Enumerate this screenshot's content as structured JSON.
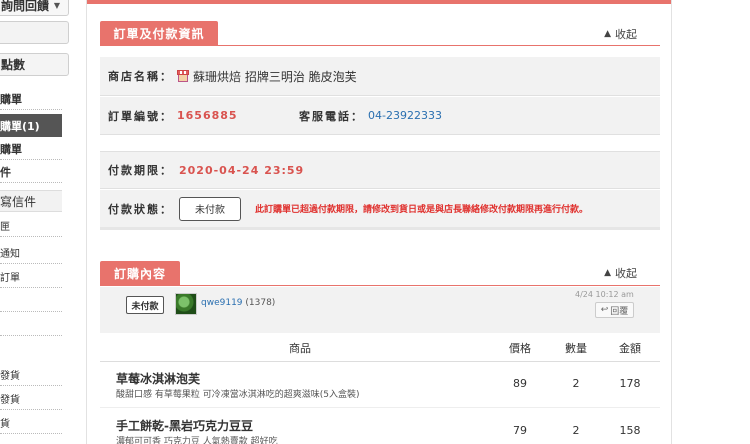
{
  "sidebar": {
    "top_label": "詢問回饋",
    "points_label": "點數",
    "items": [
      "購單",
      "購單(1)",
      "購單",
      "件"
    ],
    "write_label": "寫信件",
    "sub_items": [
      "匣",
      "通知",
      "訂單",
      "",
      "",
      "發貨",
      "發貨",
      "貨"
    ]
  },
  "payment_section": {
    "title": "訂單及付款資訊",
    "collapse_label": "收起",
    "shop_label": "商店名稱：",
    "shop_name": "蘇珊烘焙 招牌三明治 脆皮泡芙",
    "order_no_label": "訂單編號：",
    "order_no": "1656885",
    "phone_label": "客服電話：",
    "phone": "04-23922333",
    "deadline_label": "付款期限：",
    "deadline": "2020-04-24 23:59",
    "status_label": "付款狀態：",
    "status_value": "未付款",
    "warning": "此訂購單已超過付款期限，請修改到貨日或是與店長聯絡修改付款期限再進行付款。"
  },
  "order_section": {
    "title": "訂購內容",
    "collapse_label": "收起",
    "status_badge": "未付款",
    "username": "qwe9119",
    "user_count": "(1378)",
    "timestamp": "4/24  10:12 am",
    "reply_label": "回覆",
    "columns": [
      "商品",
      "價格",
      "數量",
      "金額"
    ],
    "rows": [
      {
        "name": "草莓冰淇淋泡芙",
        "desc": "酸甜口感 有草莓果粒 可冷凍當冰淇淋吃的超爽滋味(5入盒裝)",
        "price": "89",
        "qty": "2",
        "total": "178"
      },
      {
        "name": "手工餅乾-黑岩巧克力豆豆",
        "desc": "濃郁可可香 巧克力豆 人氣熱賣款 超好吃",
        "price": "79",
        "qty": "2",
        "total": "158"
      }
    ]
  },
  "colors": {
    "accent": "#e8736c",
    "red_text": "#d9534f",
    "link": "#2a6fb0"
  }
}
